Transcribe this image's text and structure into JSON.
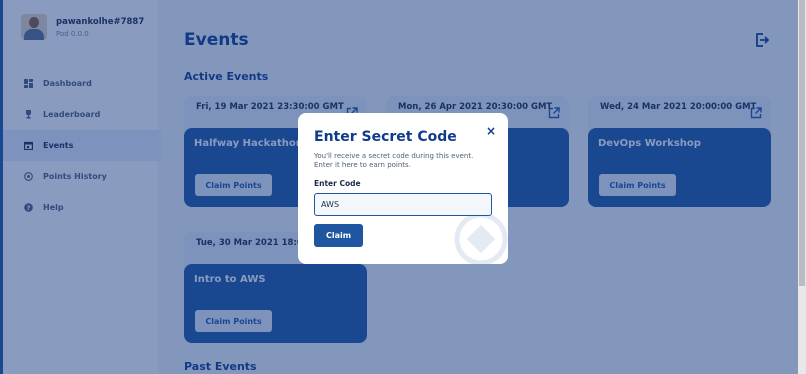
{
  "profile": {
    "username": "pawankolhe#7887",
    "pod": "Pod 0.0.0"
  },
  "nav": [
    {
      "label": "Dashboard",
      "icon": "dashboard-icon"
    },
    {
      "label": "Leaderboard",
      "icon": "trophy-icon"
    },
    {
      "label": "Events",
      "icon": "calendar-icon",
      "active": true
    },
    {
      "label": "Points History",
      "icon": "history-icon"
    },
    {
      "label": "Help",
      "icon": "help-icon"
    }
  ],
  "page": {
    "title": "Events",
    "active_section": "Active Events",
    "past_section": "Past Events"
  },
  "events": [
    {
      "date": "Fri, 19 Mar 2021 23:30:00 GMT",
      "name": "Halfway Hackathon",
      "button": "Claim Points"
    },
    {
      "date": "Mon, 26 Apr 2021 20:30:00 GMT",
      "name": "",
      "button": ""
    },
    {
      "date": "Wed, 24 Mar 2021 20:00:00 GMT",
      "name": "DevOps Workshop",
      "button": "Claim Points"
    },
    {
      "date": "Tue, 30 Mar 2021 18:00:00 GMT",
      "name": "Intro to AWS",
      "button": "Claim Points"
    }
  ],
  "modal": {
    "title": "Enter Secret Code",
    "close": "×",
    "description": "You'll receive a secret code during this event. Enter it here to earn points.",
    "field_label": "Enter Code",
    "field_value": "AWS",
    "submit": "Claim"
  },
  "colors": {
    "primary": "#1e56a0",
    "heading": "#0f3b8a",
    "overlay": "rgba(19,56,128,0.5)"
  }
}
